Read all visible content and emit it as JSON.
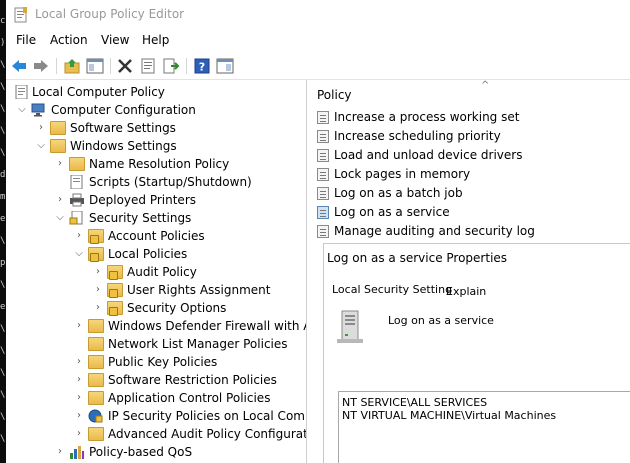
{
  "window": {
    "title": "Local Group Policy Editor"
  },
  "menu": [
    "File",
    "Action",
    "View",
    "Help"
  ],
  "toolbar": {
    "buttons": [
      "back-icon",
      "forward-icon",
      "up-folder-icon",
      "show-hide-tree-icon",
      "delete-icon",
      "properties-icon",
      "export-list-icon",
      "help-icon",
      "show-hide-action-pane-icon"
    ]
  },
  "tree": {
    "root": "Local Computer Policy",
    "computer_configuration": "Computer Configuration",
    "software_settings": "Software Settings",
    "windows_settings": "Windows Settings",
    "name_resolution_policy": "Name Resolution Policy",
    "scripts": "Scripts (Startup/Shutdown)",
    "deployed_printers": "Deployed Printers",
    "security_settings": "Security Settings",
    "account_policies": "Account Policies",
    "local_policies": "Local Policies",
    "audit_policy": "Audit Policy",
    "user_rights_assignment": "User Rights Assignment",
    "security_options": "Security Options",
    "windows_defender_firewall": "Windows Defender Firewall with A",
    "network_list_manager": "Network List Manager Policies",
    "public_key_policies": "Public Key Policies",
    "software_restriction": "Software Restriction Policies",
    "application_control": "Application Control Policies",
    "ip_security": "IP Security Policies on Local Comp",
    "advanced_audit": "Advanced Audit Policy Configurat",
    "policy_based_qos": "Policy-based QoS"
  },
  "list": {
    "header": "Policy",
    "items": [
      "Increase a process working set",
      "Increase scheduling priority",
      "Load and unload device drivers",
      "Lock pages in memory",
      "Log on as a batch job",
      "Log on as a service",
      "Manage auditing and security log"
    ],
    "selected": "Log on as a service"
  },
  "properties": {
    "title": "Log on as a service Properties",
    "tabs": [
      "Local Security Setting",
      "Explain"
    ],
    "service_name": "Log on as a service",
    "accounts": [
      "NT SERVICE\\ALL SERVICES",
      "NT VIRTUAL MACHINE\\Virtual Machines"
    ]
  }
}
